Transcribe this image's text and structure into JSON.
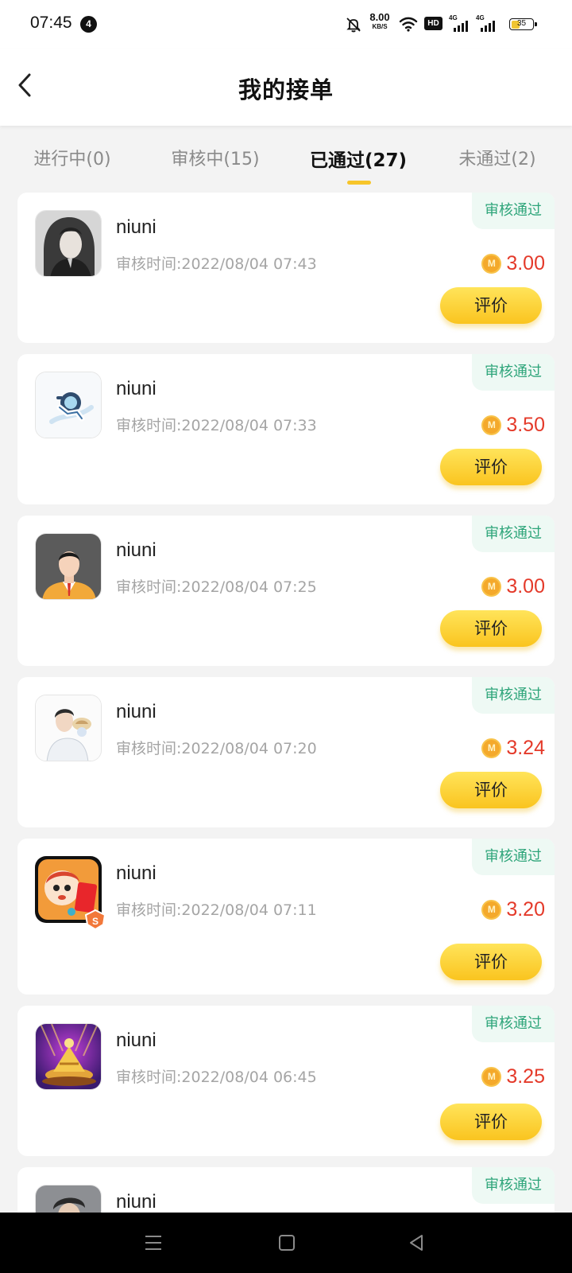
{
  "status_bar": {
    "time": "07:45",
    "notification_count": "4",
    "net_speed_value": "8.00",
    "net_speed_unit": "KB/S",
    "hd_label": "HD",
    "signal_1": "4G",
    "signal_2": "4G",
    "battery": "35",
    "battery_level": 0.35
  },
  "header": {
    "title": "我的接单"
  },
  "tabs": [
    {
      "label": "进行中(0)",
      "active": false
    },
    {
      "label": "审核中(15)",
      "active": false
    },
    {
      "label": "已通过(27)",
      "active": true
    },
    {
      "label": "未通过(2)",
      "active": false
    }
  ],
  "colors": {
    "accent": "#f7c52a",
    "badge_text": "#2ea57a",
    "badge_bg": "#eef9f4",
    "amount": "#e43a2a",
    "coin": "#f4a92b"
  },
  "orders": [
    {
      "status": "审核通过",
      "name": "niuni",
      "review_time": "审核时间:2022/08/04 07:43",
      "amount": "3.00",
      "action": "评价",
      "avatar_icon": "anime-swordsman-avatar"
    },
    {
      "status": "审核通过",
      "name": "niuni",
      "review_time": "审核时间:2022/08/04 07:33",
      "amount": "3.50",
      "action": "评价",
      "avatar_icon": "astronaut-avatar"
    },
    {
      "status": "审核通过",
      "name": "niuni",
      "review_time": "审核时间:2022/08/04 07:25",
      "amount": "3.00",
      "action": "评价",
      "avatar_icon": "businessman-avatar"
    },
    {
      "status": "审核通过",
      "name": "niuni",
      "review_time": "审核时间:2022/08/04 07:20",
      "amount": "3.24",
      "action": "评价",
      "avatar_icon": "boy-with-hat-avatar"
    },
    {
      "status": "审核通过",
      "name": "niuni",
      "review_time": "审核时间:2022/08/04 07:11",
      "amount": "3.20",
      "action": "评价",
      "avatar_icon": "cartoon-redpacket-avatar"
    },
    {
      "status": "审核通过",
      "name": "niuni",
      "review_time": "审核时间:2022/08/04 06:45",
      "amount": "3.25",
      "action": "评价",
      "avatar_icon": "golden-trophy-avatar"
    },
    {
      "status": "审核通过",
      "name": "niuni",
      "avatar_icon": "person-photo-avatar"
    }
  ],
  "coin_icon_label": "M",
  "nav_bar": {
    "icons": [
      "menu-icon",
      "home-square-icon",
      "back-triangle-icon"
    ]
  }
}
